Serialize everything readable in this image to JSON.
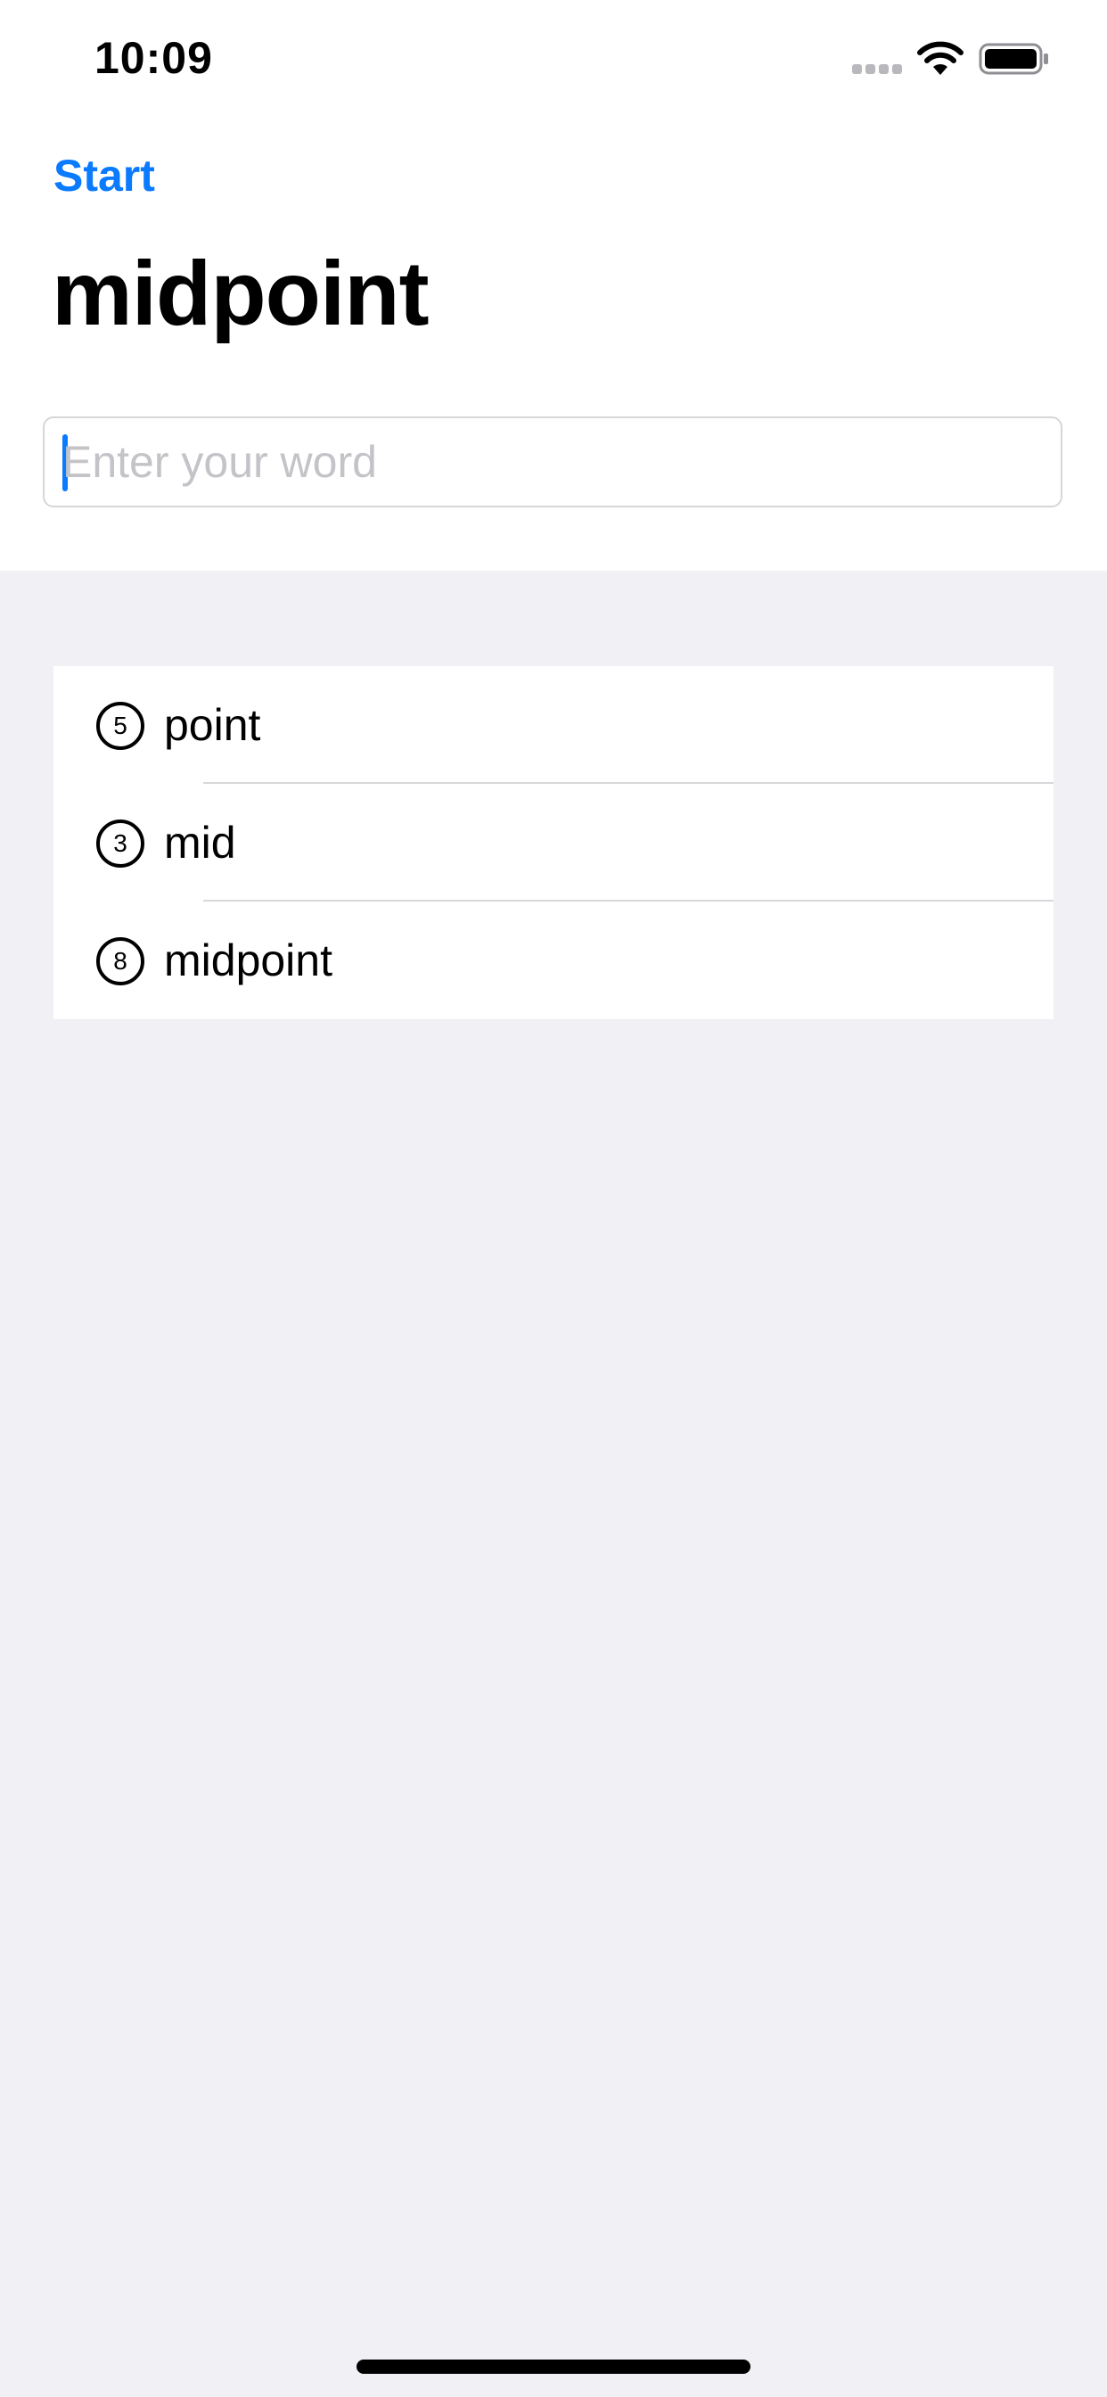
{
  "status_bar": {
    "time": "10:09",
    "icons": [
      "cellular-signal-icon",
      "wifi-icon",
      "battery-icon"
    ]
  },
  "nav": {
    "back_label": "Start",
    "title": "midpoint"
  },
  "search": {
    "value": "",
    "placeholder": "Enter your word"
  },
  "words": [
    {
      "count": "5",
      "word": "point"
    },
    {
      "count": "3",
      "word": "mid"
    },
    {
      "count": "8",
      "word": "midpoint"
    }
  ],
  "colors": {
    "accent": "#0a7aff",
    "background": "#f0f0f5",
    "card": "#ffffff",
    "separator": "#d8d8dc",
    "placeholder": "#c3c3c8"
  }
}
